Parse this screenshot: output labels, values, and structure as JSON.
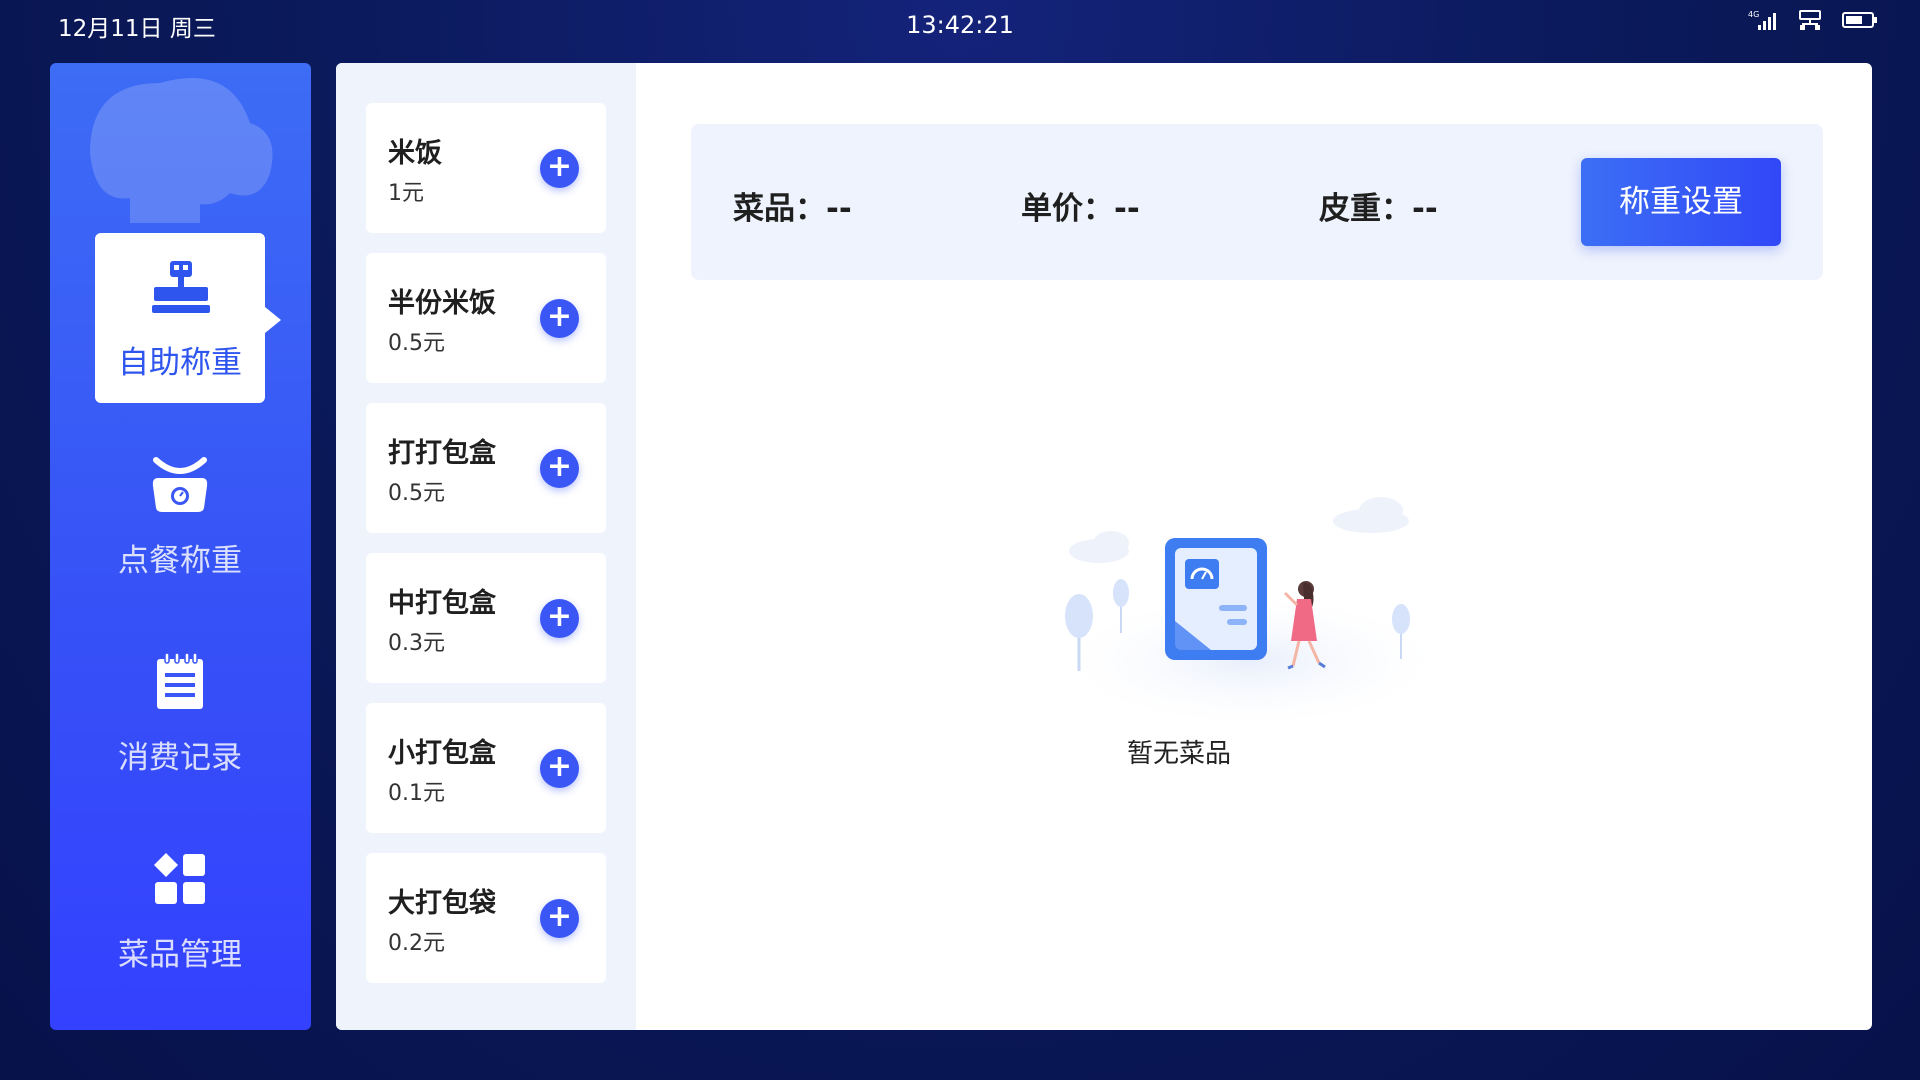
{
  "status_bar": {
    "date": "12月11日 周三",
    "time": "13:42:21",
    "icons": [
      "signal-4g-icon",
      "network-icon",
      "battery-icon"
    ]
  },
  "sidebar": {
    "items": [
      {
        "label": "自助称重",
        "icon": "scale-register-icon",
        "active": true
      },
      {
        "label": "点餐称重",
        "icon": "weighing-scale-icon",
        "active": false
      },
      {
        "label": "消费记录",
        "icon": "notepad-icon",
        "active": false
      },
      {
        "label": "菜品管理",
        "icon": "grid-apps-icon",
        "active": false
      }
    ]
  },
  "dishes": [
    {
      "name": "米饭",
      "price": "1元"
    },
    {
      "name": "半份米饭",
      "price": "0.5元"
    },
    {
      "name": "打打包盒",
      "price": "0.5元"
    },
    {
      "name": "中打包盒",
      "price": "0.3元"
    },
    {
      "name": "小打包盒",
      "price": "0.1元"
    },
    {
      "name": "大打包袋",
      "price": "0.2元"
    }
  ],
  "info": {
    "dish_label": "菜品：--",
    "price_label": "单价：--",
    "tare_label": "皮重：--",
    "setting_button": "称重设置"
  },
  "empty_state": {
    "text": "暂无菜品"
  },
  "colors": {
    "accent": "#3a56f5",
    "background": "#0b1a5c",
    "panel_list_bg": "#eff3fb"
  }
}
